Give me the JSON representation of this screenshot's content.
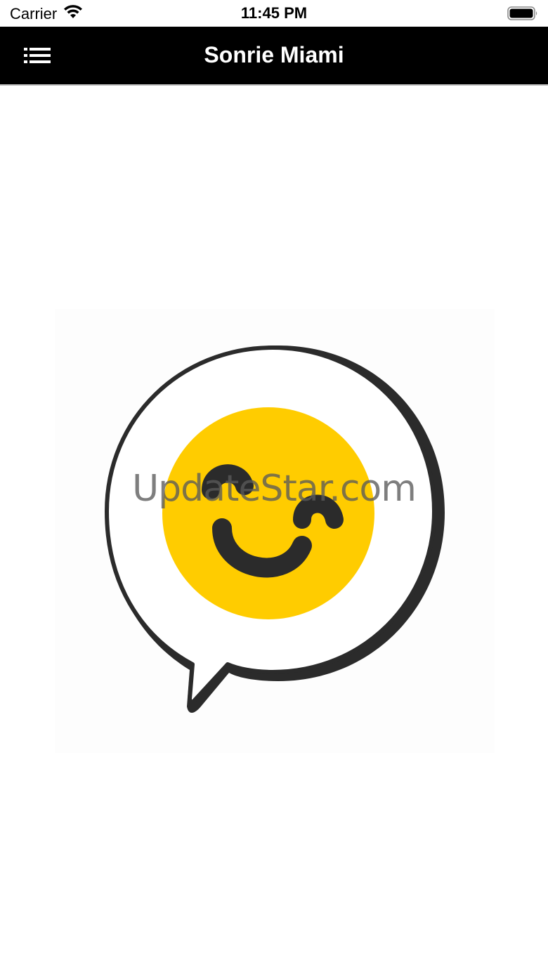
{
  "status_bar": {
    "carrier": "Carrier",
    "time": "11:45 PM",
    "wifi_icon": "wifi-icon",
    "battery_icon": "battery-icon"
  },
  "nav_bar": {
    "title": "Sonrie Miami",
    "menu_icon": "list-menu-icon",
    "background_color": "#000000"
  },
  "content": {
    "logo": {
      "icon": "smiling-face-speech-bubble-logo",
      "face_color": "#FFCC00",
      "outline_color": "#2B2B2B"
    },
    "watermark": "UpdateStar.com"
  }
}
